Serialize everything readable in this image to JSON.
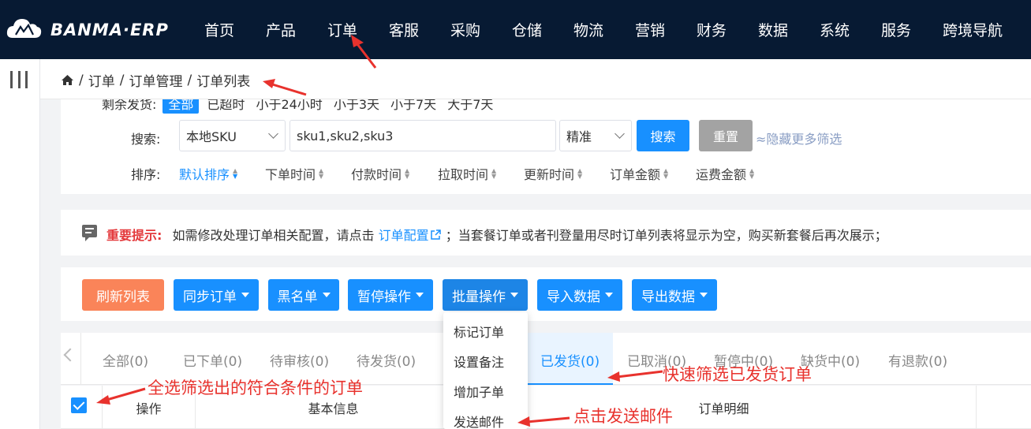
{
  "brand": {
    "logo_text": "BANMA·ERP"
  },
  "nav": {
    "items": [
      {
        "label": "首页"
      },
      {
        "label": "产品"
      },
      {
        "label": "订单"
      },
      {
        "label": "客服"
      },
      {
        "label": "采购"
      },
      {
        "label": "仓储"
      },
      {
        "label": "物流"
      },
      {
        "label": "营销"
      },
      {
        "label": "财务"
      },
      {
        "label": "数据"
      },
      {
        "label": "系统"
      },
      {
        "label": "服务"
      },
      {
        "label": "跨境导航"
      }
    ]
  },
  "breadcrumb": {
    "items": [
      "订单",
      "订单管理",
      "订单列表"
    ],
    "separator": "/"
  },
  "filter": {
    "cut_row": {
      "label": "剩余发货:",
      "chip": "全部",
      "options": [
        "已超时",
        "小于24小时",
        "小于3天",
        "小于7天",
        "大于7天"
      ]
    },
    "search_label": "搜索:",
    "search_field_select": "本地SKU",
    "search_value": "sku1,sku2,sku3",
    "match_select": "精准",
    "search_button": "搜索",
    "reset_button": "重置",
    "hide_filters": "≈隐藏更多筛选",
    "sort_label": "排序:",
    "sort_items": [
      {
        "label": "默认排序"
      },
      {
        "label": "下单时间"
      },
      {
        "label": "付款时间"
      },
      {
        "label": "拉取时间"
      },
      {
        "label": "更新时间"
      },
      {
        "label": "订单金额"
      },
      {
        "label": "运费金额"
      }
    ]
  },
  "notice": {
    "title": "重要提示:",
    "text_before": "如需修改处理订单相关配置，请点击",
    "link": "订单配置",
    "text_after": "；当套餐订单或者刊登量用尽时订单列表将显示为空，购买新套餐后再次展示；"
  },
  "actions": {
    "refresh": "刷新列表",
    "sync": "同步订单",
    "blacklist": "黑名单",
    "pause": "暂停操作",
    "batch": "批量操作",
    "import": "导入数据",
    "export": "导出数据"
  },
  "dropdown": {
    "items": [
      "标记订单",
      "设置备注",
      "增加子单",
      "发送邮件"
    ]
  },
  "tabs": {
    "items": [
      {
        "label": "全部(0)"
      },
      {
        "label": "已下单(0)"
      },
      {
        "label": "待审核(0)"
      },
      {
        "label": "待发货(0)"
      },
      {
        "label": "已发货(0)",
        "active": true
      },
      {
        "label": "已取消(0)"
      },
      {
        "label": "暂停中(0)"
      },
      {
        "label": "缺货中(0)"
      },
      {
        "label": "有退款(0)"
      }
    ]
  },
  "table": {
    "headers": [
      "操作",
      "基本信息",
      "订单明细"
    ]
  },
  "annotations": {
    "select_all": "全选筛选出的符合条件的订单",
    "quick_filter": "快速筛选已发货订单",
    "send_mail": "点击发送邮件"
  },
  "colors": {
    "nav_bg": "#071a33",
    "primary": "#1890ff",
    "orange": "#fa8459",
    "annotation": "#e8322d"
  }
}
